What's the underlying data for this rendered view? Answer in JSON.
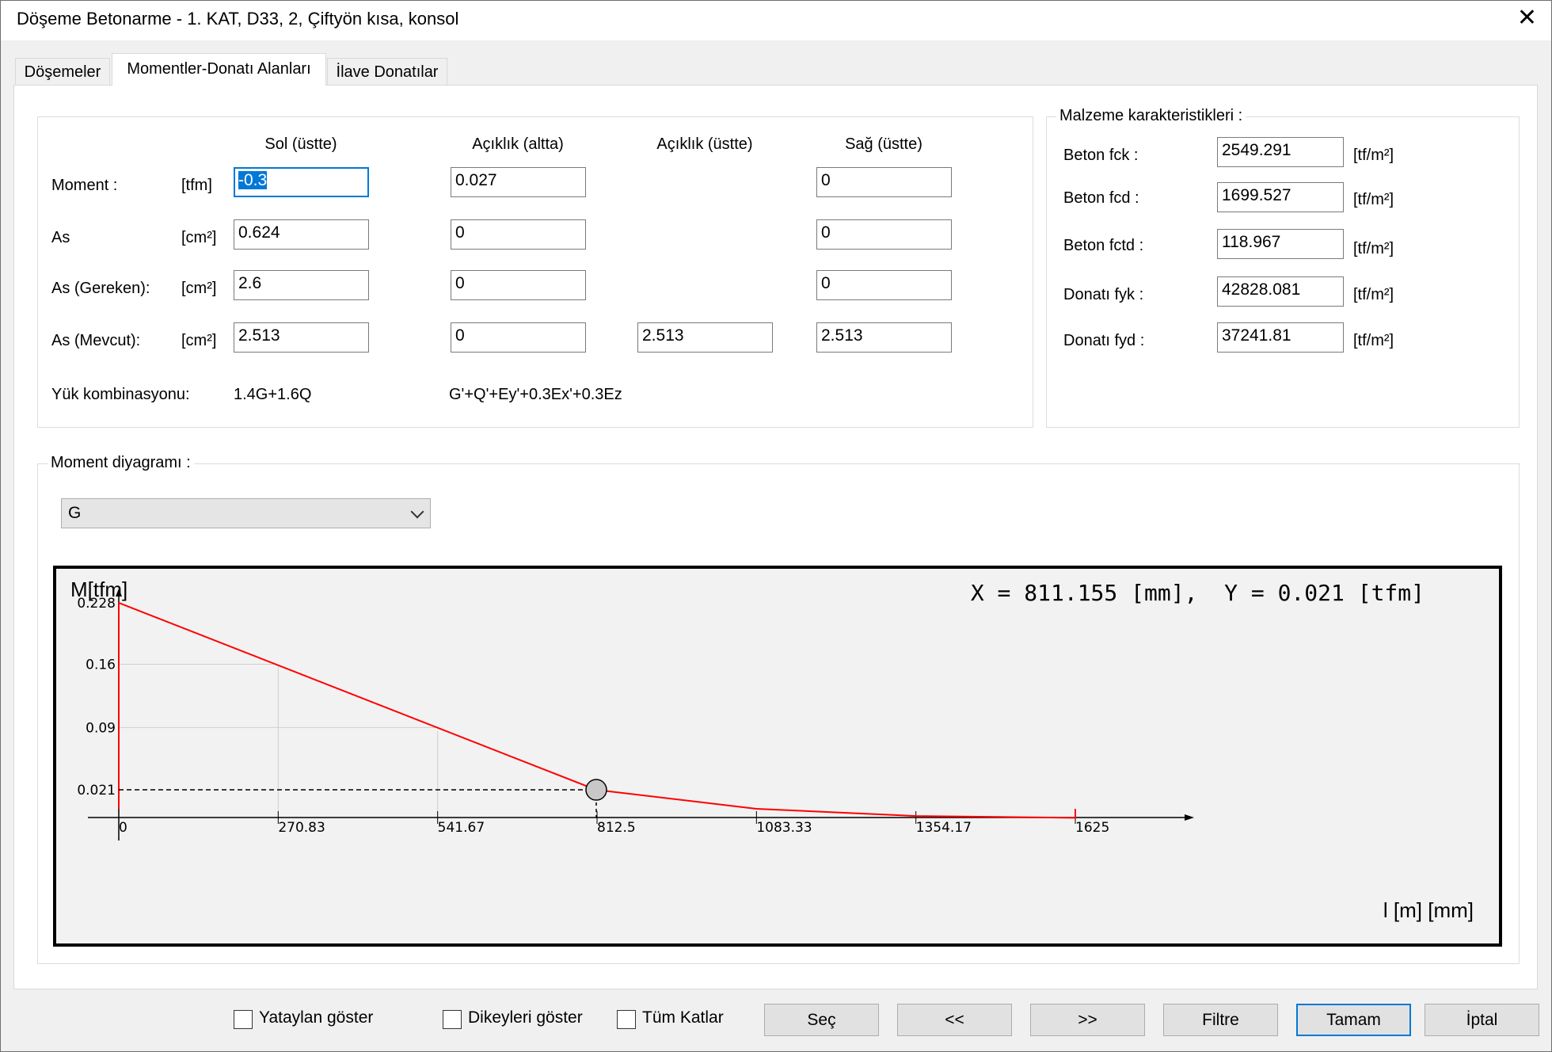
{
  "window": {
    "title": "Döşeme Betonarme - 1. KAT, D33, 2, Çiftyön kısa, konsol",
    "close_glyph": "✕"
  },
  "tabs": [
    {
      "label": "Döşemeler",
      "active": false
    },
    {
      "label": "Momentler-Donatı Alanları",
      "active": true
    },
    {
      "label": "İlave Donatılar",
      "active": false
    }
  ],
  "moments": {
    "headers": {
      "sol": "Sol (üstte)",
      "aciklik_alt": "Açıklık (altta)",
      "aciklik_ust": "Açıklık (üstte)",
      "sag": "Sağ (üstte)"
    },
    "rows": {
      "moment": {
        "label": "Moment :",
        "unit": "[tfm]",
        "sol": "-0.3",
        "aciklik_alt": "0.027",
        "sag": "0"
      },
      "as": {
        "label": "As",
        "unit": "[cm²]",
        "sol": "0.624",
        "aciklik_alt": "0",
        "sag": "0"
      },
      "as_gereken": {
        "label": "As (Gereken):",
        "unit": "[cm²]",
        "sol": "2.6",
        "aciklik_alt": "0",
        "sag": "0"
      },
      "as_mevcut": {
        "label": "As (Mevcut):",
        "unit": "[cm²]",
        "sol": "2.513",
        "aciklik_alt": "0",
        "aciklik_ust": "2.513",
        "sag": "2.513"
      }
    },
    "yuk": {
      "label": "Yük kombinasyonu:",
      "sol": "1.4G+1.6Q",
      "aciklik": "G'+Q'+Ey'+0.3Ex'+0.3Ez"
    }
  },
  "material": {
    "title": "Malzeme karakteristikleri :",
    "unit": "[tf/m²]",
    "items": [
      {
        "label": "Beton fck :",
        "value": "2549.291"
      },
      {
        "label": "Beton fcd :",
        "value": "1699.527"
      },
      {
        "label": "Beton fctd :",
        "value": "118.967"
      },
      {
        "label": "Donatı fyk :",
        "value": "42828.081"
      },
      {
        "label": "Donatı fyd :",
        "value": "37241.81"
      }
    ]
  },
  "diagram": {
    "title": "Moment diyagramı :",
    "combo_value": "G"
  },
  "chart_data": {
    "type": "line",
    "ylabel": "M[tfm]",
    "xlabel": "l [m] [mm]",
    "readout": "X = 811.155 [mm],  Y = 0.021 [tfm]",
    "x_ticks": [
      "0",
      "270.83",
      "541.67",
      "812.5",
      "1083.33",
      "1354.17",
      "1625"
    ],
    "y_ticks": [
      "0.021",
      "0.09",
      "0.16",
      "0.228"
    ],
    "xlim": [
      0,
      1625
    ],
    "ylim": [
      0,
      0.228
    ],
    "series": [
      {
        "x": [
          0,
          0,
          811.155,
          1083.33,
          1354.17,
          1625,
          1625
        ],
        "y": [
          0,
          0.228,
          0.021,
          0.0,
          -0.008,
          -0.01,
          0.0
        ]
      }
    ],
    "cursor": {
      "x": 811.155,
      "y": 0.021
    },
    "grid": true,
    "line_color": "#ff0000"
  },
  "footer": {
    "checkboxes": [
      {
        "label": "Yataylan göster",
        "checked": false
      },
      {
        "label": "Dikeyleri göster",
        "checked": false
      },
      {
        "label": "Tüm Katlar",
        "checked": false
      }
    ],
    "buttons": {
      "sec": "Seç",
      "prev": "<<",
      "next": ">>",
      "filtre": "Filtre",
      "tamam": "Tamam",
      "iptal": "İptal"
    }
  }
}
